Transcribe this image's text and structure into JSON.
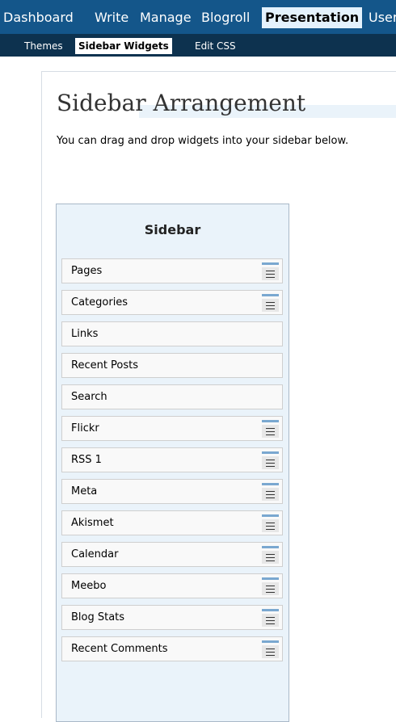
{
  "topnav": {
    "tabs": [
      {
        "label": "Dashboard",
        "active": false
      },
      {
        "label": "Write",
        "active": false
      },
      {
        "label": "Manage",
        "active": false
      },
      {
        "label": "Blogroll",
        "active": false
      },
      {
        "label": "Presentation",
        "active": true
      },
      {
        "label": "Users",
        "active": false
      }
    ]
  },
  "subnav": {
    "tabs": [
      {
        "label": "Themes",
        "active": false
      },
      {
        "label": "Sidebar Widgets",
        "active": true
      },
      {
        "label": "Edit CSS",
        "active": false
      }
    ]
  },
  "page": {
    "title": "Sidebar Arrangement",
    "description": "You can drag and drop widgets into your sidebar below."
  },
  "sidebar": {
    "title": "Sidebar",
    "widgets": [
      {
        "label": "Pages",
        "configurable": true
      },
      {
        "label": "Categories",
        "configurable": true
      },
      {
        "label": "Links",
        "configurable": false
      },
      {
        "label": "Recent Posts",
        "configurable": false
      },
      {
        "label": "Search",
        "configurable": false
      },
      {
        "label": "Flickr",
        "configurable": true
      },
      {
        "label": "RSS 1",
        "configurable": true
      },
      {
        "label": "Meta",
        "configurable": true
      },
      {
        "label": "Akismet",
        "configurable": true
      },
      {
        "label": "Calendar",
        "configurable": true
      },
      {
        "label": "Meebo",
        "configurable": true
      },
      {
        "label": "Blog Stats",
        "configurable": true
      },
      {
        "label": "Recent Comments",
        "configurable": true
      }
    ]
  },
  "colors": {
    "topnav_bg": "#14568a",
    "subnav_bg": "#0d324f",
    "panel_bg": "#eaf3fa",
    "handle_accent": "#7aa8d0"
  }
}
